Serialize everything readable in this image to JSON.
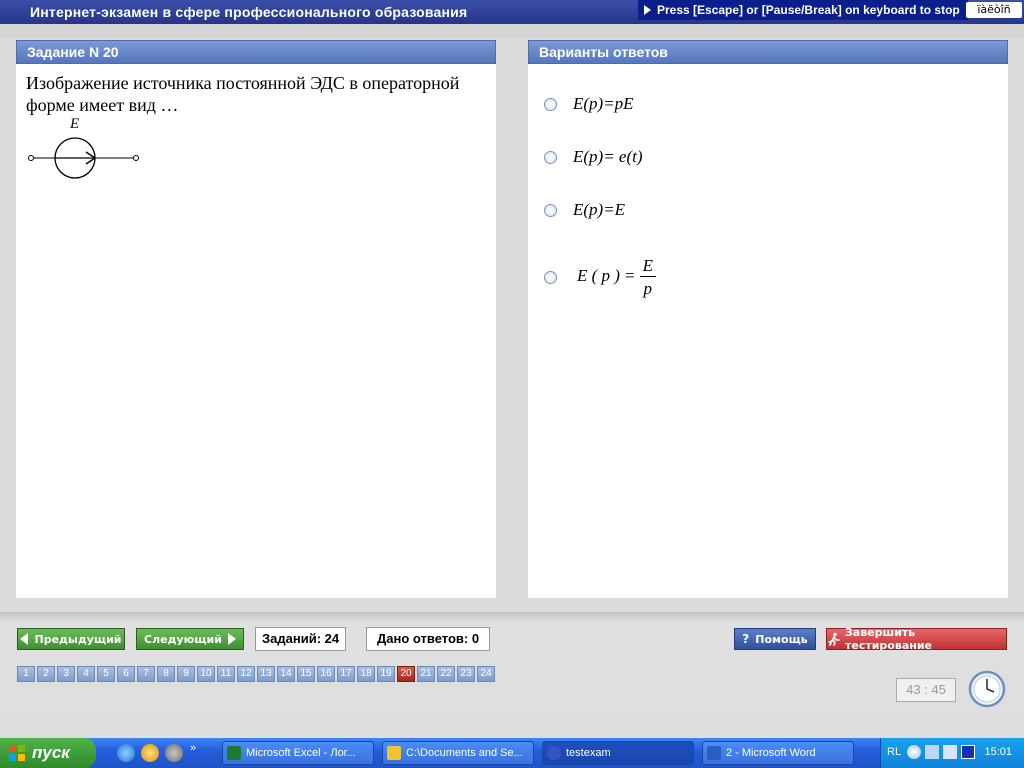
{
  "window": {
    "title": "Интернет-экзамен в сфере профессионального образования",
    "escape_hint": "Press [Escape] or [Pause/Break] on keyboard to stop",
    "lang_box": "ïàëòîñ"
  },
  "question_panel": {
    "header": "Задание N 20",
    "text": "Изображение источника постоянной ЭДС в операторной форме имеет вид …",
    "figure_label": "E"
  },
  "answers_panel": {
    "header": "Варианты ответов",
    "options": [
      {
        "text": "E(p)=pE"
      },
      {
        "text": "E(p)= e(t)"
      },
      {
        "text": "E(p)=E"
      },
      {
        "lhs": "E ( p )",
        "op": "=",
        "numerator": "E",
        "denominator": "p"
      }
    ]
  },
  "navigation": {
    "prev_label": "Предыдущий",
    "next_label": "Следующий",
    "total_label": "Заданий: 24",
    "answered_label": "Дано ответов: 0",
    "help_label": "Помощь",
    "finish_label": "Завершить тестирование",
    "pages": [
      "1",
      "2",
      "3",
      "4",
      "5",
      "6",
      "7",
      "8",
      "9",
      "10",
      "11",
      "12",
      "13",
      "14",
      "15",
      "16",
      "17",
      "18",
      "19",
      "20",
      "21",
      "22",
      "23",
      "24"
    ],
    "current_page": "20",
    "timer": "43 : 45"
  },
  "taskbar": {
    "start_label": "пуск",
    "tasks": [
      {
        "label": "Microsoft Excel - Лог...",
        "color": "#1d7a34"
      },
      {
        "label": "C:\\Documents and Se...",
        "color": "#f1c232"
      },
      {
        "label": "testexam",
        "color": "#3554c8"
      },
      {
        "label": "2 - Microsoft Word",
        "color": "#2b5fbf"
      }
    ],
    "tray_lang": "RL",
    "clock": "15:01"
  },
  "colors": {
    "header_blue": "#5577bd",
    "nav_green": "#3e8f2f",
    "help_blue": "#2f4f9c",
    "finish_red": "#bf3136",
    "active_page": "#a52a1e"
  }
}
